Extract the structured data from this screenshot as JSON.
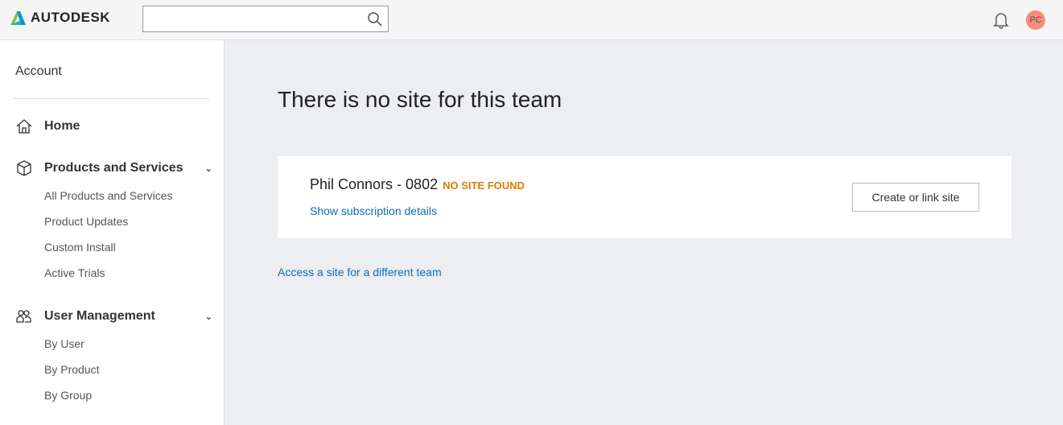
{
  "header": {
    "brand": "AUTODESK",
    "search_placeholder": "",
    "avatar_initials": "PC"
  },
  "sidebar": {
    "title": "Account",
    "home": "Home",
    "products": {
      "label": "Products and Services",
      "items": [
        "All Products and Services",
        "Product Updates",
        "Custom Install",
        "Active Trials"
      ]
    },
    "users": {
      "label": "User Management",
      "items": [
        "By User",
        "By Product",
        "By Group"
      ]
    }
  },
  "main": {
    "title": "There is no site for this team",
    "team_name": "Phil Connors - 0802",
    "status": "NO SITE FOUND",
    "show_details": "Show subscription details",
    "create_button": "Create or link site",
    "other_team_link": "Access a site for a different team"
  },
  "colors": {
    "status": "#e07a00",
    "link": "#0b6eb8",
    "avatar": "#fb8c7a"
  }
}
